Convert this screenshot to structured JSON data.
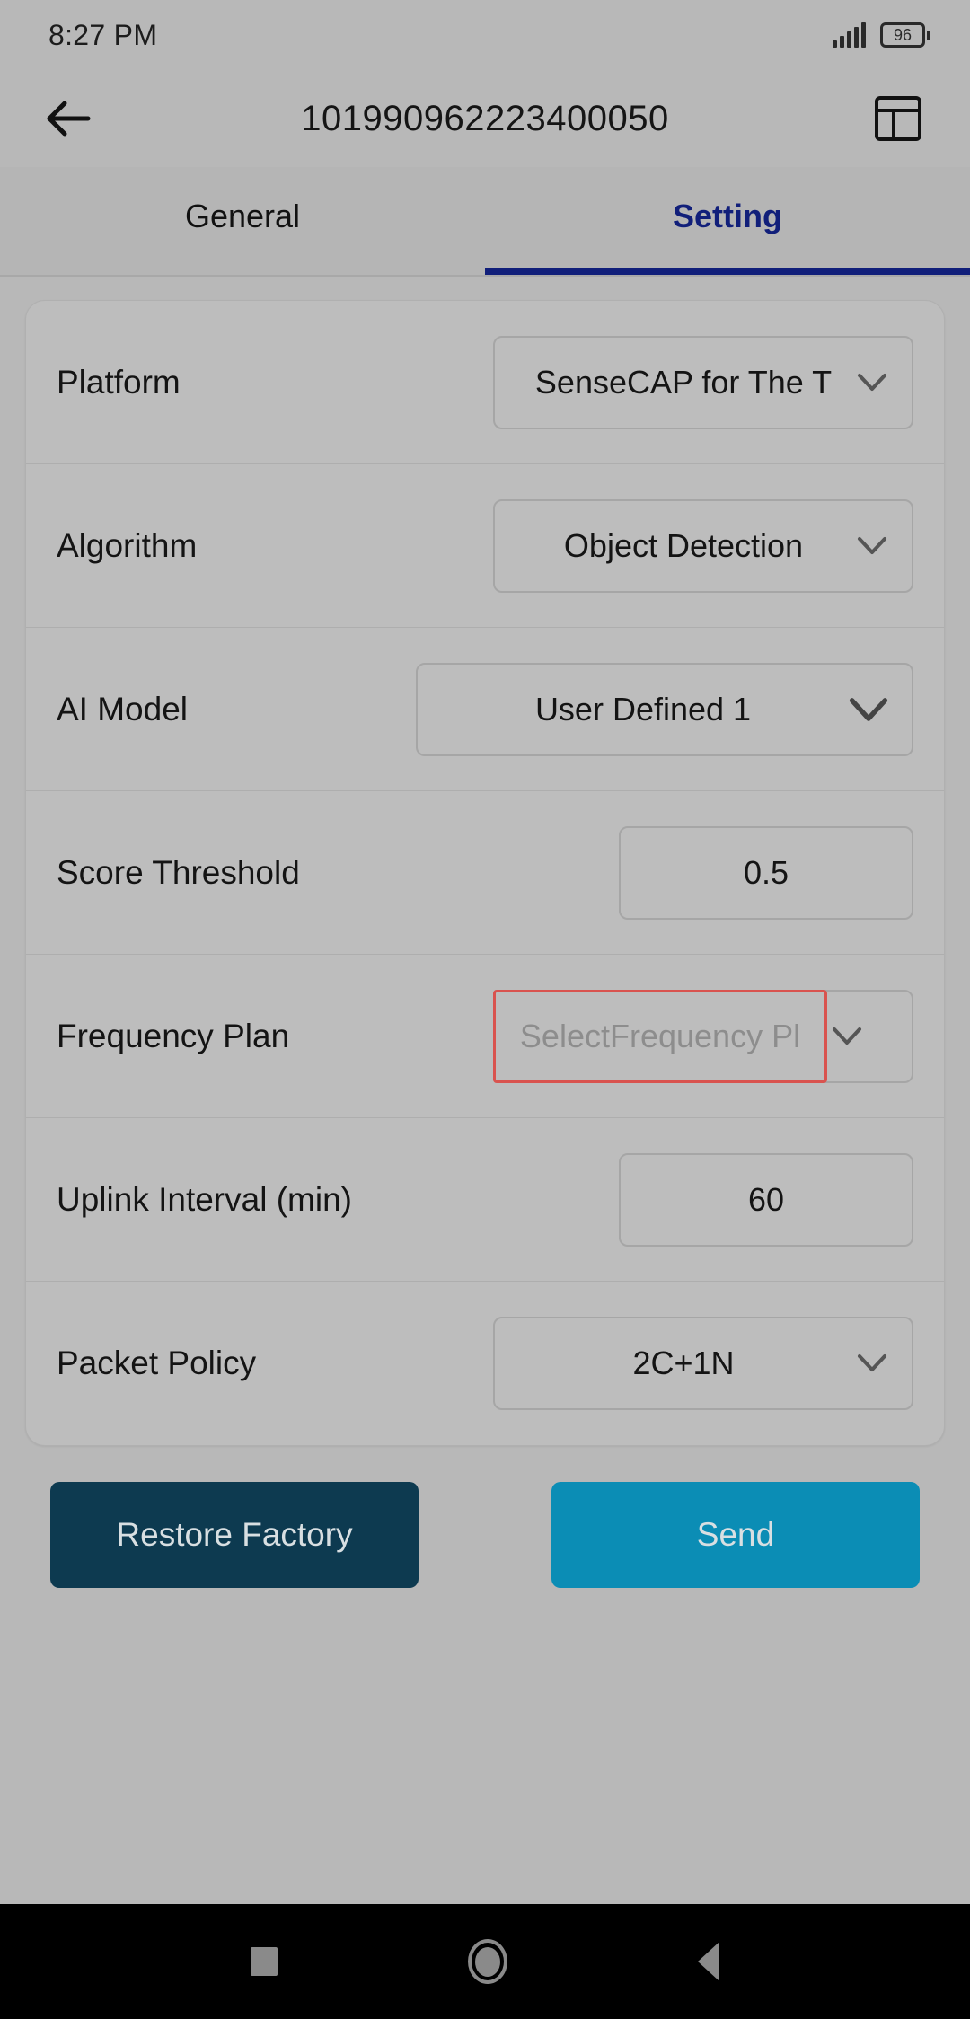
{
  "status_bar": {
    "time": "8:27 PM",
    "signal_icon": "signal-bars-icon",
    "battery_level": "96",
    "battery_icon": "battery-icon"
  },
  "app_bar": {
    "back_icon": "back-arrow-icon",
    "title": "101990962223400050",
    "panel_icon": "panel-layout-icon"
  },
  "tabs": [
    {
      "label": "General",
      "active": false
    },
    {
      "label": "Setting",
      "active": true
    }
  ],
  "settings": {
    "rows": [
      {
        "label": "Platform",
        "value": "SenseCAP for The T",
        "type": "select",
        "state": "normal"
      },
      {
        "label": "Algorithm",
        "value": "Object Detection",
        "type": "select",
        "state": "normal"
      },
      {
        "label": "AI Model",
        "value": "User Defined 1",
        "type": "select-wide",
        "state": "normal"
      },
      {
        "label": "Score Threshold",
        "value": "0.5",
        "type": "input",
        "state": "normal"
      },
      {
        "label": "Frequency Plan",
        "value": "SelectFrequency Pl",
        "type": "select-error",
        "state": "error"
      },
      {
        "label": "Uplink Interval (min)",
        "value": "60",
        "type": "input",
        "state": "normal"
      },
      {
        "label": "Packet Policy",
        "value": "2C+1N",
        "type": "select",
        "state": "normal"
      }
    ]
  },
  "actions": {
    "restore_label": "Restore Factory",
    "send_label": "Send"
  },
  "nav_bar": {
    "recents_icon": "square-recents-icon",
    "home_icon": "circle-home-icon",
    "back_icon": "triangle-back-icon"
  },
  "colors": {
    "accent_tab": "#111f7a",
    "error_border": "#d9534f",
    "restore_bg": "#0d3a50",
    "send_bg": "#0b8db5",
    "page_bg": "#b8b8b8"
  }
}
